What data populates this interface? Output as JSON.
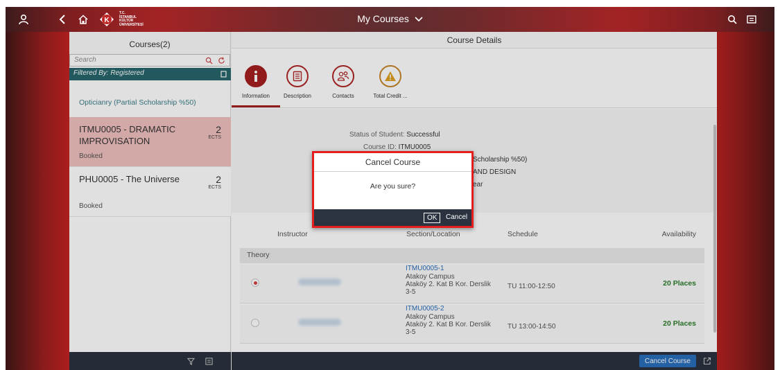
{
  "shell": {
    "title": "My Courses",
    "logo_text": "T.C.\nİSTANBUL\nKÜLTÜR\nÜNİVERSİTESİ",
    "accent": "#a51f1f"
  },
  "master": {
    "header": "Courses(2)",
    "search_placeholder": "Search",
    "filter_text": "Filtered By: Registered",
    "group_header": "Opticianry (Partial Scholarship %50)",
    "items": [
      {
        "title": "ITMU0005 - DRAMATIC IMPROVISATION",
        "number": "2",
        "unit": "ECTS",
        "status": "Booked"
      },
      {
        "title": "PHU0005 - The Universe",
        "number": "2",
        "unit": "ECTS",
        "status": "Booked"
      }
    ]
  },
  "detail": {
    "header": "Course Details",
    "tabs": [
      {
        "label": "Information",
        "icon": "info-icon"
      },
      {
        "label": "Description",
        "icon": "document-icon"
      },
      {
        "label": "Contacts",
        "icon": "people-icon"
      },
      {
        "label": "Total Credit ...",
        "icon": "warning-icon"
      }
    ],
    "info": {
      "status_label": "Status of Student:",
      "status_value": "Successful",
      "course_id_label": "Course ID:",
      "course_id_value": "ITMU0005",
      "line3_value": "Scholarship %50)",
      "line4_value": "AND DESIGN",
      "line5_value": "ear"
    },
    "table": {
      "columns": [
        "Instructor",
        "Section/Location",
        "Schedule",
        "Availability"
      ],
      "group": "Theory",
      "rows": [
        {
          "code": "ITMU0005-1",
          "campus": "Atakoy Campus",
          "room": "Ataköy 2. Kat B Kor. Derslik 3-5",
          "schedule": "TU 11:00-12:50",
          "availability": "20 Places",
          "selected": true
        },
        {
          "code": "ITMU0005-2",
          "campus": "Atakoy Campus",
          "room": "Ataköy 2. Kat B Kor. Derslik 3-5",
          "schedule": "TU 13:00-14:50",
          "availability": "20 Places",
          "selected": false
        }
      ]
    },
    "footer_button": "Cancel Course"
  },
  "dialog": {
    "title": "Cancel Course",
    "message": "Are you sure?",
    "ok": "OK",
    "cancel": "Cancel"
  }
}
